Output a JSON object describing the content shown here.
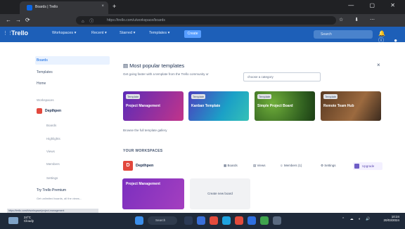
{
  "browser": {
    "tab_title": "Boards | Trello",
    "tab_close": "×",
    "new_tab": "+",
    "window_controls": "—  ▢  ✕",
    "url": "https://trello.com/u/workspace/boards",
    "back": "←",
    "forward": "→",
    "reload": "⟳",
    "nav_icons": "⌂ ⓘ",
    "right_icons": "☆ ⬇ ⋯"
  },
  "trello_nav": {
    "logo": "Trello",
    "apps_icon": "⋮⋮",
    "menus": [
      "Workspaces ▾",
      "Recent ▾",
      "Starred ▾",
      "Templates ▾"
    ],
    "create_label": "Create",
    "search_placeholder": "Search",
    "right_icons": "🔔 ⓘ ●"
  },
  "sidebar": {
    "boards": "Boards",
    "templates": "Templates",
    "home": "Home",
    "workspaces_header": "Workspaces",
    "workspace_name": "Depthpen",
    "workspace_items": [
      "Boards",
      "Highlights",
      "Views",
      "Members",
      "Settings"
    ],
    "try_premium": "Try Trello Premium",
    "premium_desc": "Get unlimited boards, all the views..."
  },
  "main": {
    "most_popular_title": "Most popular templates",
    "most_popular_sub": "Get going faster with a template from the Trello community or",
    "category_select": "choose a category",
    "close_icon": "×",
    "templates": [
      {
        "badge": "Template",
        "title": "Project Management"
      },
      {
        "badge": "Template",
        "title": "Kanban Template"
      },
      {
        "badge": "Template",
        "title": "Simple Project Board"
      },
      {
        "badge": "Template",
        "title": "Remote Team Hub"
      }
    ],
    "browse_link": "Browse the full template gallery",
    "your_workspaces": "YOUR WORKSPACES",
    "workspace_initial": "D",
    "workspace_name": "Depthpen",
    "ws_buttons": [
      "Boards",
      "Views",
      "Members (1)",
      "Settings",
      "Upgrade"
    ],
    "board_card_title": "Project Management",
    "create_new_board": "Create new board"
  },
  "status_url": "https://trello.com/b/workspace/project-management",
  "taskbar": {
    "weather_temp": "24°C",
    "weather_desc": "Cloudy",
    "search_label": "Search",
    "tray": "⌃ ☁ ◐ 🔊",
    "time": "10:24",
    "date": "20/03/2024"
  }
}
